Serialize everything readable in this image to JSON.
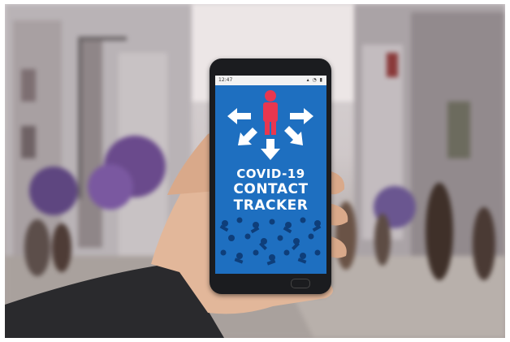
{
  "status_bar": {
    "time": "12:47",
    "icons": "▴ ◔ ▮"
  },
  "app": {
    "title_line1": "COVID-19",
    "title_line2": "CONTACT",
    "title_line3": "TRACKER"
  },
  "colors": {
    "screen_blue": "#1e6fc0",
    "person_red": "#e8374f",
    "icon_white": "#ffffff",
    "crowd_dark_blue": "#0e3e7a"
  }
}
